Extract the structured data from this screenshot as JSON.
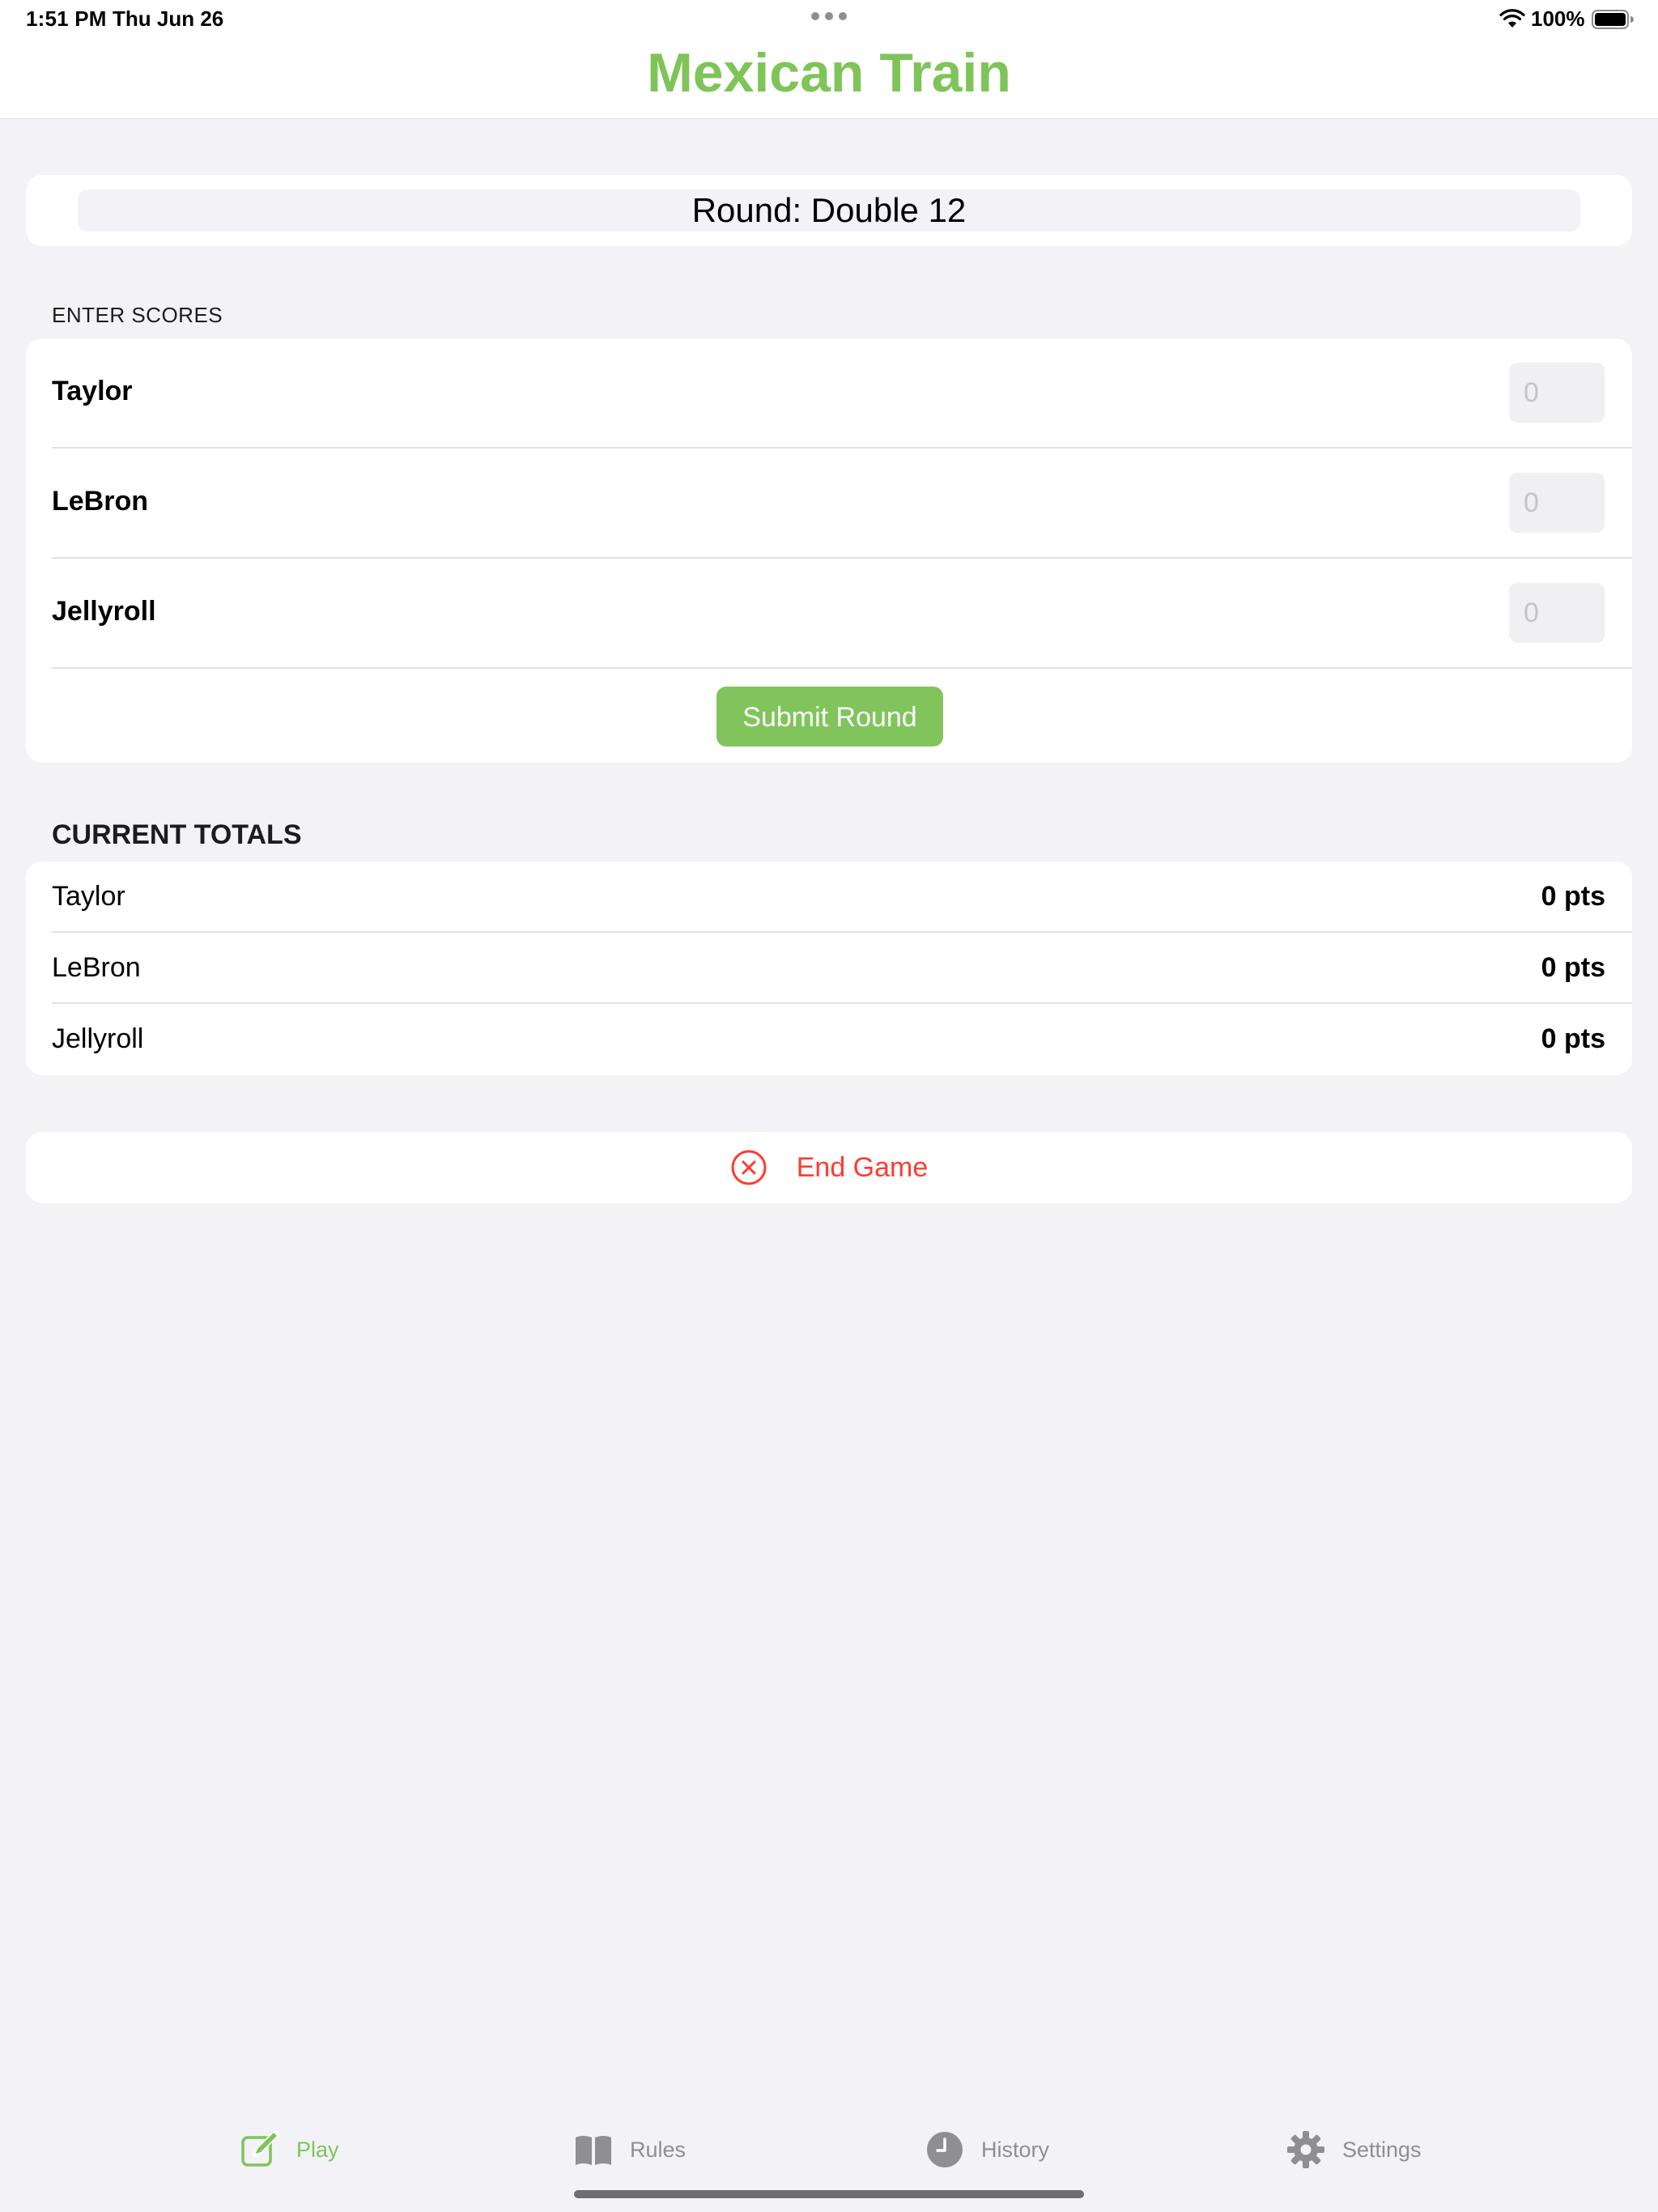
{
  "status_bar": {
    "time": "1:51 PM",
    "date": "Thu Jun 26",
    "battery": "100%",
    "wifi_icon": "wifi-icon",
    "battery_icon": "battery-full-icon"
  },
  "app": {
    "title": "Mexican Train",
    "accent_color": "#7FC459",
    "destructive_color": "#FF3B30"
  },
  "round": {
    "label": "Round: Double 12"
  },
  "enter_scores": {
    "header": "ENTER SCORES",
    "players": [
      {
        "name": "Taylor",
        "placeholder": "0",
        "value": ""
      },
      {
        "name": "LeBron",
        "placeholder": "0",
        "value": ""
      },
      {
        "name": "Jellyroll",
        "placeholder": "0",
        "value": ""
      }
    ],
    "submit_label": "Submit Round"
  },
  "current_totals": {
    "header": "CURRENT TOTALS",
    "rows": [
      {
        "name": "Taylor",
        "points": "0 pts"
      },
      {
        "name": "LeBron",
        "points": "0 pts"
      },
      {
        "name": "Jellyroll",
        "points": "0 pts"
      }
    ]
  },
  "end_game": {
    "label": "End Game",
    "icon": "xmark-circle-icon"
  },
  "tab_bar": {
    "selected": "Play",
    "tabs": [
      {
        "label": "Play",
        "icon": "square-pencil-icon"
      },
      {
        "label": "Rules",
        "icon": "book-icon"
      },
      {
        "label": "History",
        "icon": "clock-icon"
      },
      {
        "label": "Settings",
        "icon": "gear-icon"
      }
    ]
  }
}
